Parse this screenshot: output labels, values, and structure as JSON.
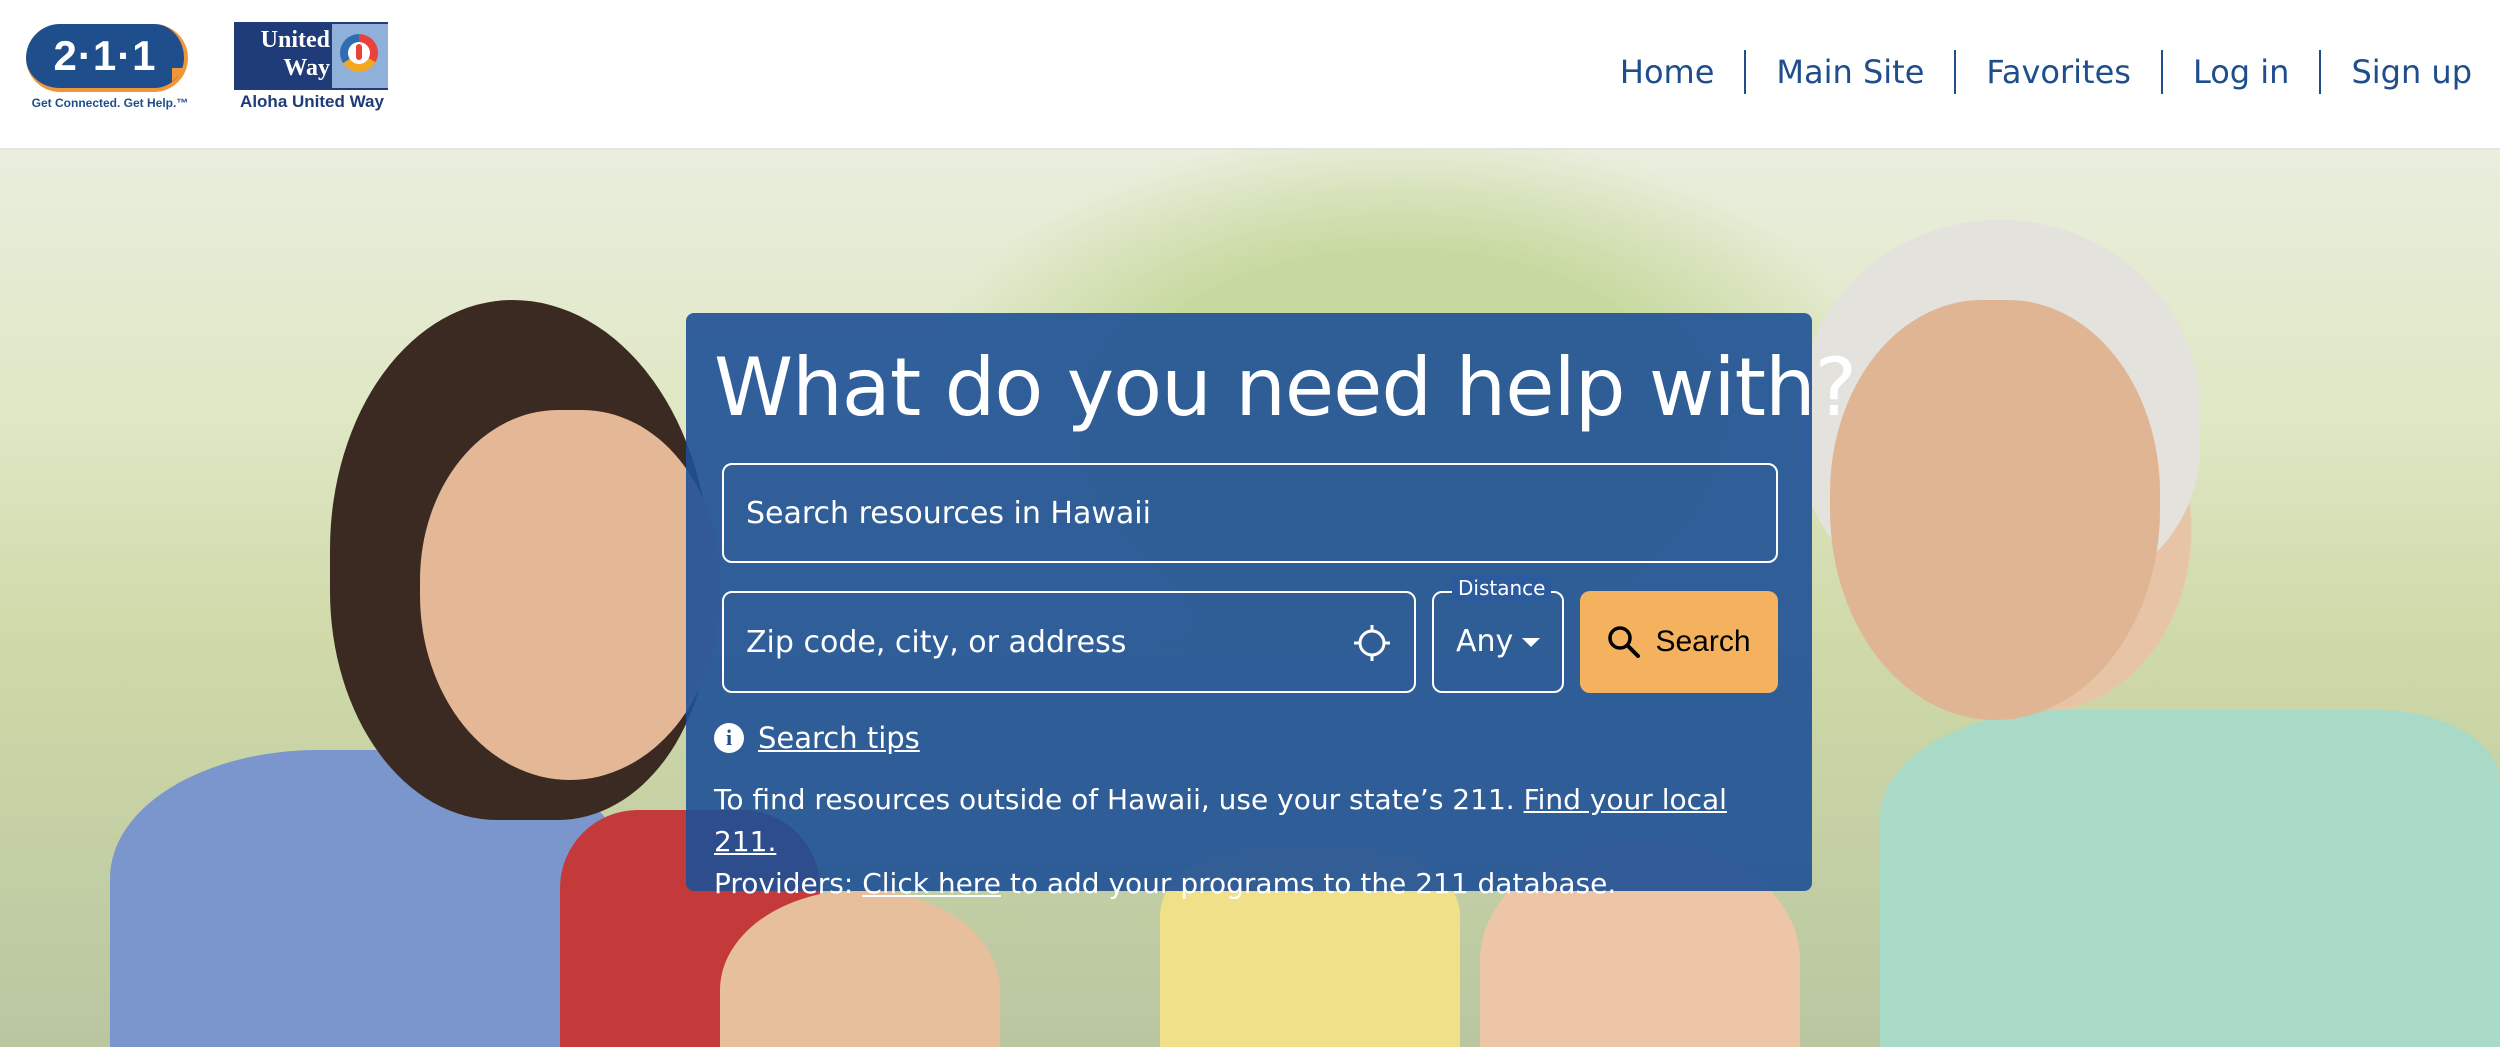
{
  "header": {
    "logo_211": {
      "text": "2·1·1",
      "tagline": "Get Connected. Get Help.™"
    },
    "logo_united_way": {
      "wordmark_line1": "United",
      "wordmark_line2": "Way",
      "caption": "Aloha United Way"
    },
    "nav": [
      {
        "label": "Home"
      },
      {
        "label": "Main Site"
      },
      {
        "label": "Favorites"
      },
      {
        "label": "Log in"
      },
      {
        "label": "Sign up"
      }
    ]
  },
  "search_panel": {
    "heading": "What do you need help with?",
    "search_placeholder": "Search resources in Hawaii",
    "location_placeholder": "Zip code, city, or address",
    "distance_label": "Distance",
    "distance_value": "Any",
    "search_button": "Search",
    "search_tips": "Search tips",
    "outside_text": "To find resources outside of Hawaii, use your state’s 211.",
    "outside_link": "Find your local 211.",
    "providers_prefix": "Providers:",
    "providers_link": "Click here",
    "providers_suffix": "to add your programs to the 211 database."
  },
  "colors": {
    "brand_blue": "#1f4e8c",
    "panel_blue": "#1e5096",
    "button_orange": "#f5b25e",
    "accent_orange": "#f0963a"
  },
  "icons": {
    "location": "crosshair-icon",
    "search": "magnifier-icon",
    "info": "info-icon",
    "dropdown": "caret-down-icon"
  }
}
